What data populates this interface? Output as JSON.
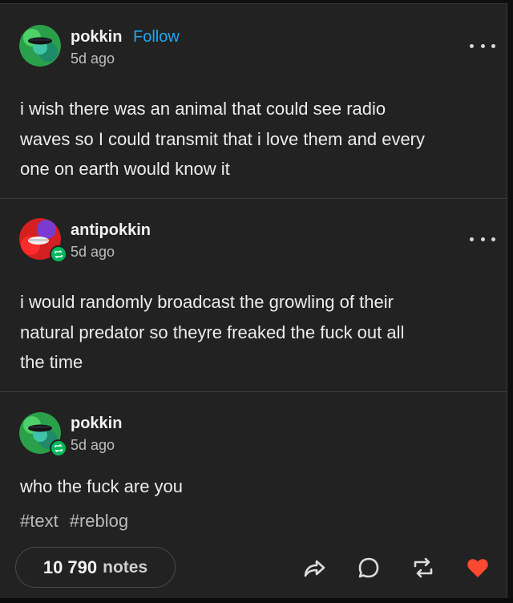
{
  "posts": [
    {
      "username": "pokkin",
      "follow_label": "Follow",
      "time": "5d ago",
      "text_lines": [
        "i wish there was an animal that could see radio",
        "waves so I could transmit that i love them and every",
        "one on earth would know it"
      ]
    },
    {
      "username": "antipokkin",
      "time": "5d ago",
      "text_lines": [
        "i would randomly broadcast the growling of their",
        "natural predator so theyre freaked the fuck out all",
        "the time"
      ]
    },
    {
      "username": "pokkin",
      "time": "5d ago",
      "text_lines": [
        "who the fuck are you"
      ]
    }
  ],
  "tags": [
    "#text",
    "#reblog"
  ],
  "footer": {
    "notes_count": "10 790",
    "notes_label": "notes"
  },
  "colors": {
    "accent": "#1fa7ee",
    "like": "#ff4930",
    "reblog_green": "#00b85c",
    "background": "#222222"
  },
  "icons": [
    "more-icon",
    "reblog-icon",
    "share-icon",
    "reply-icon",
    "like-icon"
  ]
}
